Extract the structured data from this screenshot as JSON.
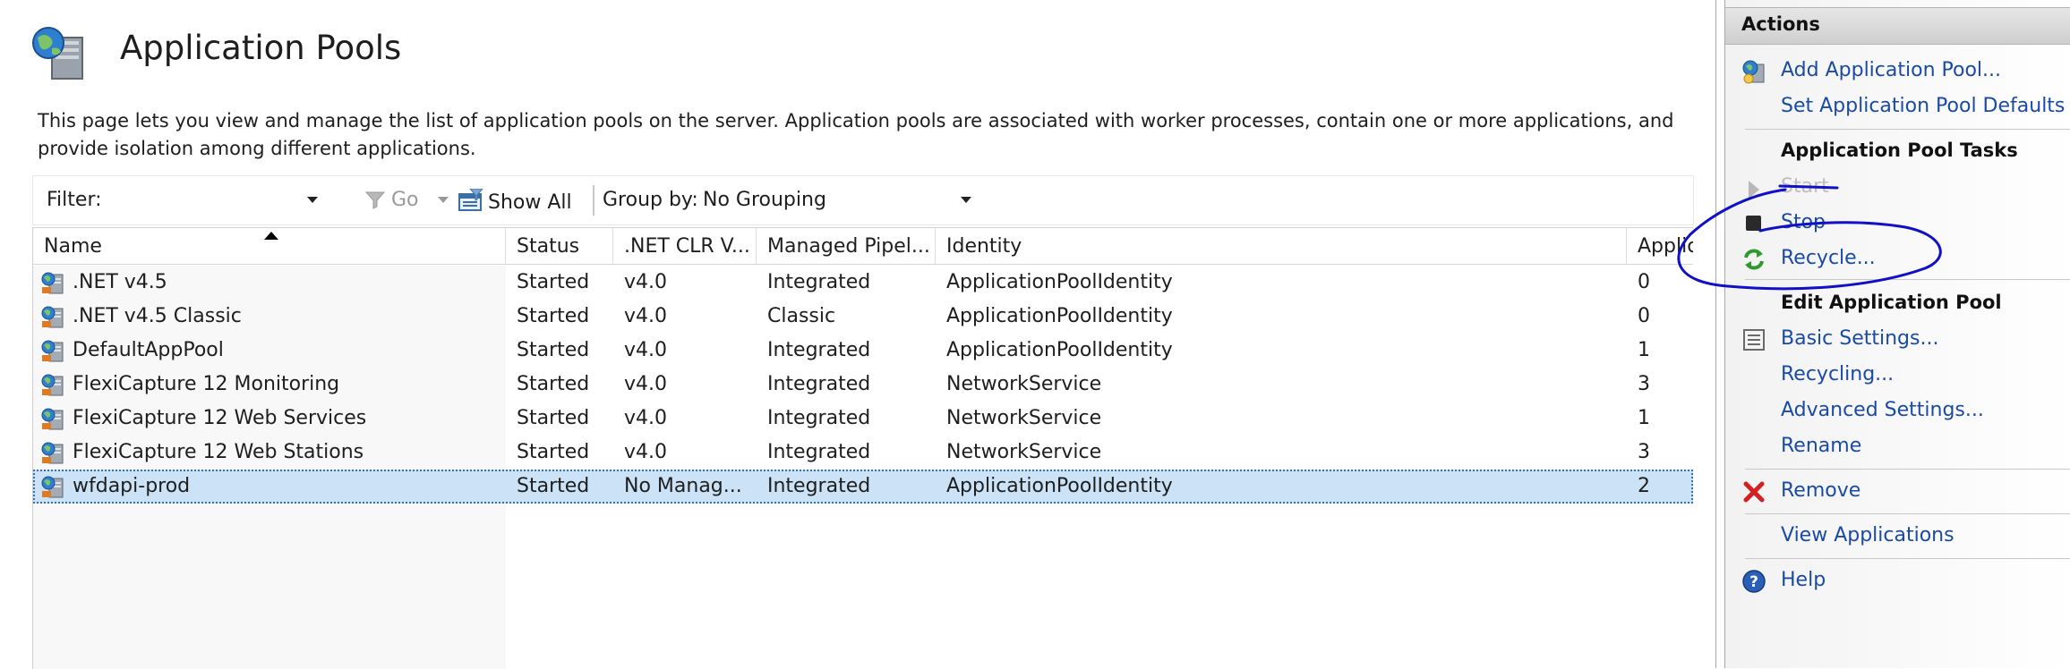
{
  "page": {
    "title": "Application Pools",
    "description": "This page lets you view and manage the list of application pools on the server. Application pools are associated with worker processes, contain one or more applications, and provide isolation among different applications."
  },
  "toolbar": {
    "filter_label": "Filter:",
    "filter_value": "",
    "go_label": "Go",
    "show_all_label": "Show All",
    "group_by_label": "Group by:",
    "group_by_value": "No Grouping"
  },
  "table": {
    "columns": [
      "Name",
      "Status",
      ".NET CLR V...",
      "Managed Pipel...",
      "Identity",
      "Applic"
    ],
    "rows": [
      {
        "name": ".NET v4.5",
        "status": "Started",
        "clr": "v4.0",
        "pipeline": "Integrated",
        "identity": "ApplicationPoolIdentity",
        "apps": "0"
      },
      {
        "name": ".NET v4.5 Classic",
        "status": "Started",
        "clr": "v4.0",
        "pipeline": "Classic",
        "identity": "ApplicationPoolIdentity",
        "apps": "0"
      },
      {
        "name": "DefaultAppPool",
        "status": "Started",
        "clr": "v4.0",
        "pipeline": "Integrated",
        "identity": "ApplicationPoolIdentity",
        "apps": "1"
      },
      {
        "name": "FlexiCapture 12 Monitoring",
        "status": "Started",
        "clr": "v4.0",
        "pipeline": "Integrated",
        "identity": "NetworkService",
        "apps": "3"
      },
      {
        "name": "FlexiCapture 12 Web Services",
        "status": "Started",
        "clr": "v4.0",
        "pipeline": "Integrated",
        "identity": "NetworkService",
        "apps": "1"
      },
      {
        "name": "FlexiCapture 12 Web Stations",
        "status": "Started",
        "clr": "v4.0",
        "pipeline": "Integrated",
        "identity": "NetworkService",
        "apps": "3"
      },
      {
        "name": "wfdapi-prod",
        "status": "Started",
        "clr": "No Manag...",
        "pipeline": "Integrated",
        "identity": "ApplicationPoolIdentity",
        "apps": "2",
        "selected": true
      }
    ]
  },
  "actions": {
    "title": "Actions",
    "add_pool": "Add Application Pool...",
    "set_defaults": "Set Application Pool Defaults",
    "tasks_title": "Application Pool Tasks",
    "start": "Start",
    "stop": "Stop",
    "recycle": "Recycle...",
    "edit_title": "Edit Application Pool",
    "basic_settings": "Basic Settings...",
    "recycling": "Recycling...",
    "advanced_settings": "Advanced Settings...",
    "rename": "Rename",
    "remove": "Remove",
    "view_applications": "View Applications",
    "help": "Help"
  },
  "colors": {
    "link": "#1a4aa8",
    "selection": "#cce3f7",
    "annotation_ink": "#1010c8",
    "remove_icon": "#d42020",
    "recycle_icon": "#2e9a2e"
  },
  "icons": [
    "application-pools-icon",
    "pool-icon",
    "funnel-icon",
    "show-all-icon",
    "add-pool-icon",
    "start-icon",
    "stop-icon",
    "recycle-icon",
    "basic-settings-icon",
    "remove-icon",
    "help-icon"
  ]
}
